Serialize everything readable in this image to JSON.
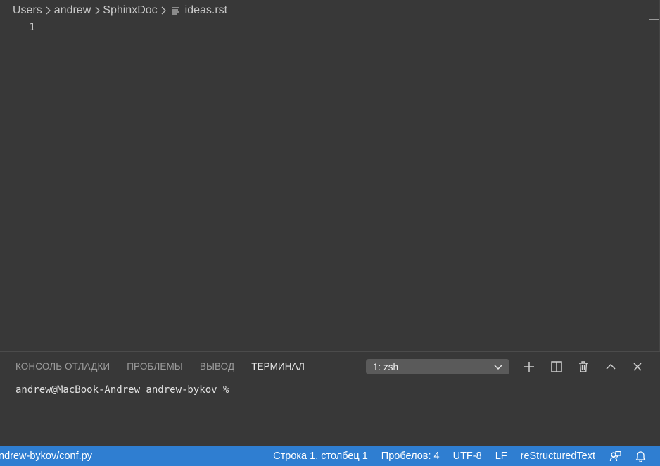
{
  "breadcrumb": {
    "items": [
      "Users",
      "andrew",
      "SphinxDoc"
    ],
    "file": "ideas.rst"
  },
  "editor": {
    "line_numbers": [
      "1"
    ]
  },
  "panel": {
    "tabs": [
      {
        "label": "КОНСОЛЬ ОТЛАДКИ",
        "active": false
      },
      {
        "label": "ПРОБЛЕМЫ",
        "active": false
      },
      {
        "label": "ВЫВОД",
        "active": false
      },
      {
        "label": "ТЕРМИНАЛ",
        "active": true
      }
    ],
    "terminal_selector": "1: zsh",
    "actions": [
      "plus-icon",
      "split-terminal-icon",
      "trash-icon",
      "maximize-panel-icon",
      "close-panel-icon"
    ]
  },
  "terminal": {
    "prompt": "andrew@MacBook-Andrew andrew-bykov % "
  },
  "statusbar": {
    "path": "ndrew-bykov/conf.py",
    "cursor_position": "Строка 1, столбец 1",
    "indentation": "Пробелов: 4",
    "encoding": "UTF-8",
    "eol": "LF",
    "language": "reStructuredText",
    "icons": [
      "feedback-icon",
      "bell-icon"
    ]
  },
  "colors": {
    "editor_background": "#383838",
    "statusbar_background": "#2f7ed1",
    "terminal_select_background": "#5a5a5a"
  }
}
